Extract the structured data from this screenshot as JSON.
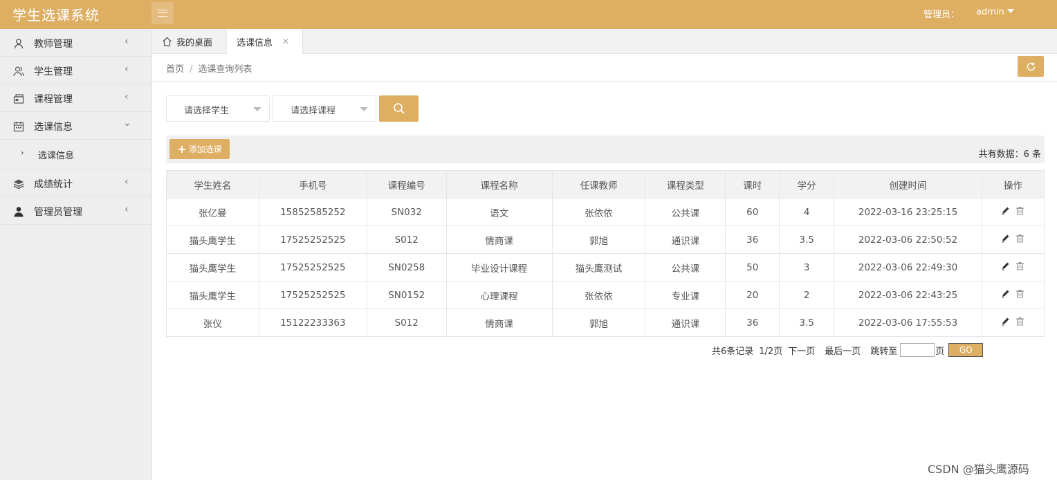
{
  "header": {
    "app_title": "学生选课系统",
    "admin_label": "管理员：",
    "admin_name": "admin"
  },
  "sidebar": {
    "items": [
      {
        "label": "教师管理",
        "icon": "user-icon"
      },
      {
        "label": "学生管理",
        "icon": "users-icon"
      },
      {
        "label": "课程管理",
        "icon": "course-icon"
      },
      {
        "label": "选课信息",
        "icon": "calendar-icon",
        "expanded": true
      },
      {
        "label": "成绩统计",
        "icon": "layers-icon"
      },
      {
        "label": "管理员管理",
        "icon": "person-icon"
      }
    ],
    "sub_items": [
      {
        "label": "选课信息"
      }
    ]
  },
  "tabs": [
    {
      "label": "我的桌面"
    },
    {
      "label": "选课信息",
      "active": true
    }
  ],
  "breadcrumb": {
    "home": "首页",
    "separator": "/",
    "current": "选课查询列表"
  },
  "filters": {
    "student_select": "请选择学生",
    "course_select": "请选择课程"
  },
  "toolbar": {
    "add_label": "添加选课",
    "total_label": "共有数据：6 条"
  },
  "table": {
    "columns": [
      "学生姓名",
      "手机号",
      "课程编号",
      "课程名称",
      "任课教师",
      "课程类型",
      "课时",
      "学分",
      "创建时间",
      "操作"
    ],
    "rows": [
      [
        "张亿曼",
        "15852585252",
        "SN032",
        "语文",
        "张依依",
        "公共课",
        "60",
        "4",
        "2022-03-16 23:25:15"
      ],
      [
        "猫头鹰学生",
        "17525252525",
        "S012",
        "情商课",
        "郭旭",
        "通识课",
        "36",
        "3.5",
        "2022-03-06 22:50:52"
      ],
      [
        "猫头鹰学生",
        "17525252525",
        "SN0258",
        "毕业设计课程",
        "猫头鹰测试",
        "公共课",
        "50",
        "3",
        "2022-03-06 22:49:30"
      ],
      [
        "猫头鹰学生",
        "17525252525",
        "SN0152",
        "心理课程",
        "张依依",
        "专业课",
        "20",
        "2",
        "2022-03-06 22:43:25"
      ],
      [
        "张仪",
        "15122233363",
        "S012",
        "情商课",
        "郭旭",
        "通识课",
        "36",
        "3.5",
        "2022-03-06 17:55:53"
      ]
    ]
  },
  "pagination": {
    "records": "共6条记录",
    "pages": "1/2页",
    "next": "下一页",
    "last": "最后一页",
    "jump_label": "跳转至",
    "page_unit": "页",
    "go": "GO"
  },
  "watermark": "CSDN @猫头鹰源码",
  "colors": {
    "accent": "#deae63",
    "sidebar_bg": "#eeeeee"
  }
}
